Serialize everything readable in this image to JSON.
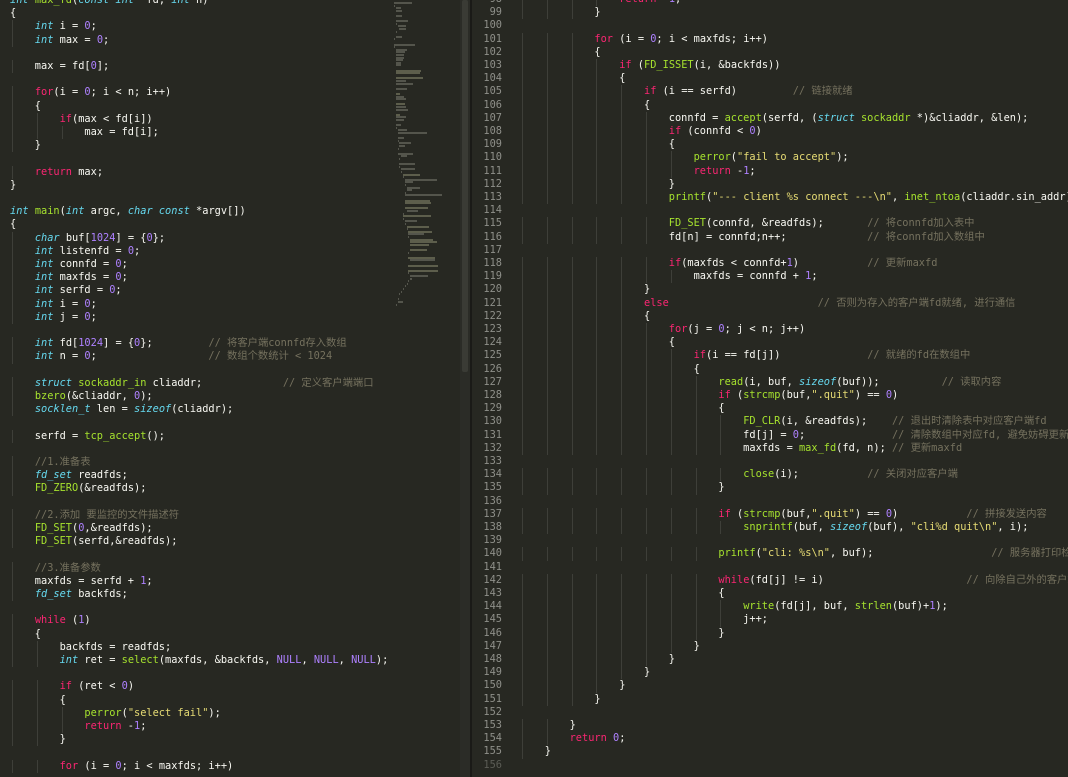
{
  "left_pane": {
    "lines": [
      "int max_fd(const int *fd, int n)",
      "{",
      "    int i = 0;",
      "    int max = 0;",
      "",
      "    max = fd[0];",
      "",
      "    for(i = 0; i < n; i++)",
      "    {",
      "        if(max < fd[i])",
      "            max = fd[i];",
      "    }",
      "",
      "    return max;",
      "}",
      "",
      "int main(int argc, char const *argv[])",
      "{",
      "    char buf[1024] = {0};",
      "    int listenfd = 0;",
      "    int connfd = 0;",
      "    int maxfds = 0;",
      "    int serfd = 0;",
      "    int i = 0;",
      "    int j = 0;",
      "",
      "    int fd[1024] = {0};         // 将客户端connfd存入数组",
      "    int n = 0;                  // 数组个数统计 < 1024",
      "",
      "    struct sockaddr_in cliaddr;             // 定义客户端端口",
      "    bzero(&cliaddr, 0);",
      "    socklen_t len = sizeof(cliaddr);",
      "",
      "    serfd = tcp_accept();",
      "",
      "    //1.准备表",
      "    fd_set readfds;",
      "    FD_ZERO(&readfds);",
      "",
      "    //2.添加 要监控的文件描述符",
      "    FD_SET(0,&readfds);",
      "    FD_SET(serfd,&readfds);",
      "",
      "    //3.准备参数",
      "    maxfds = serfd + 1;",
      "    fd_set backfds;",
      "",
      "    while (1)",
      "    {",
      "        backfds = readfds;",
      "        int ret = select(maxfds, &backfds, NULL, NULL, NULL);",
      "",
      "        if (ret < 0)",
      "        {",
      "            perror(\"select fail\");",
      "            return -1;",
      "        }",
      "",
      "        for (i = 0; i < maxfds; i++)"
    ]
  },
  "right_pane": {
    "first_line_number": 98,
    "lines": [
      "                return -1;",
      "            }",
      "",
      "            for (i = 0; i < maxfds; i++)",
      "            {",
      "                if (FD_ISSET(i, &backfds))",
      "                {",
      "                    if (i == serfd)         // 链接就绪",
      "                    {",
      "                        connfd = accept(serfd, (struct sockaddr *)&cliaddr, &len);",
      "                        if (connfd < 0)",
      "                        {",
      "                            perror(\"fail to accept\");",
      "                            return -1;",
      "                        }",
      "                        printf(\"--- client %s connect ---\\n\", inet_ntoa(cliaddr.sin_addr));",
      "",
      "                        FD_SET(connfd, &readfds);       // 将connfd加入表中",
      "                        fd[n] = connfd;n++;             // 将connfd加入数组中",
      "",
      "                        if(maxfds < connfd+1)           // 更新maxfd",
      "                            maxfds = connfd + 1;",
      "                    }",
      "                    else                        // 否则为存入的客户端fd就绪, 进行通信",
      "                    {",
      "                        for(j = 0; j < n; j++)",
      "                        {",
      "                            if(i == fd[j])              // 就绪的fd在数组中",
      "                            {",
      "                                read(i, buf, sizeof(buf));          // 读取内容",
      "                                if (strcmp(buf,\".quit\") == 0)",
      "                                {",
      "                                    FD_CLR(i, &readfds);    // 退出时清除表中对应客户端fd",
      "                                    fd[j] = 0;              // 清除数组中对应fd, 避免妨碍更新maxfd",
      "                                    maxfds = max_fd(fd, n); // 更新maxfd",
      "",
      "                                    close(i);           // 关闭对应客户端",
      "                                }",
      "",
      "                                if (strcmp(buf,\".quit\") == 0)           // 拼接发送内容",
      "                                    snprintf(buf, sizeof(buf), \"cli%d quit\\n\", i);",
      "",
      "                                printf(\"cli: %s\\n\", buf);                   // 服务器打印检测",
      "",
      "                                while(fd[j] != i)                       // 向除自己外的客户端广播",
      "                                {",
      "                                    write(fd[j], buf, strlen(buf)+1);",
      "                                    j++;",
      "                                }",
      "                            }",
      "                        }",
      "                    }",
      "                }",
      "            }",
      "",
      "        }",
      "        return 0;",
      "    }",
      ""
    ]
  },
  "colors": {
    "background": "#272822",
    "text": "#f8f8f2",
    "keyword": "#66d9ef",
    "control": "#f92672",
    "function": "#a6e22e",
    "number": "#ae81ff",
    "string": "#e6db74",
    "comment": "#75715e",
    "line_number": "#8f908a"
  },
  "icons": {
    "minimap": "code-minimap",
    "scrollbar": "vertical-scrollbar"
  }
}
